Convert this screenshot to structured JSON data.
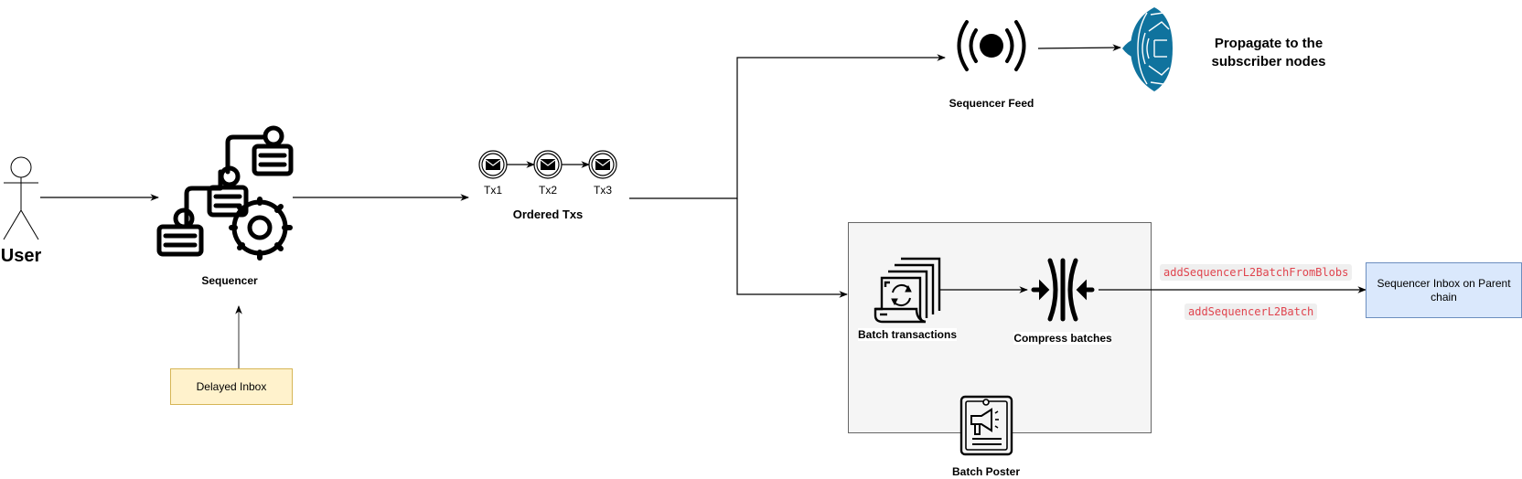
{
  "diagram": {
    "actor": {
      "label": "User"
    },
    "sequencer": {
      "label": "Sequencer"
    },
    "delayed_inbox": {
      "label": "Delayed Inbox",
      "fill": "#fff2cc",
      "stroke": "#d6b656"
    },
    "ordered_txs": {
      "label": "Ordered Txs",
      "txs": [
        "Tx1",
        "Tx2",
        "Tx3"
      ]
    },
    "sequencer_feed": {
      "label": "Sequencer Feed"
    },
    "subscribers": {
      "label_line1": "Propagate to the",
      "label_line2": "subscriber nodes",
      "icon_color": "#10739e"
    },
    "batch_poster_group": {
      "label": "Batch Poster",
      "fill": "#f5f5f5",
      "stroke": "#666666",
      "batch_transactions": {
        "label": "Batch transactions"
      },
      "compress_batches": {
        "label": "Compress batches"
      }
    },
    "edge_labels": {
      "blobs": "addSequencerL2BatchFromBlobs",
      "calldata": "addSequencerL2Batch",
      "color": "#e0444e"
    },
    "sequencer_inbox": {
      "label": "Sequencer Inbox on Parent chain",
      "fill": "#dae8fc",
      "stroke": "#6c8ebf"
    }
  }
}
